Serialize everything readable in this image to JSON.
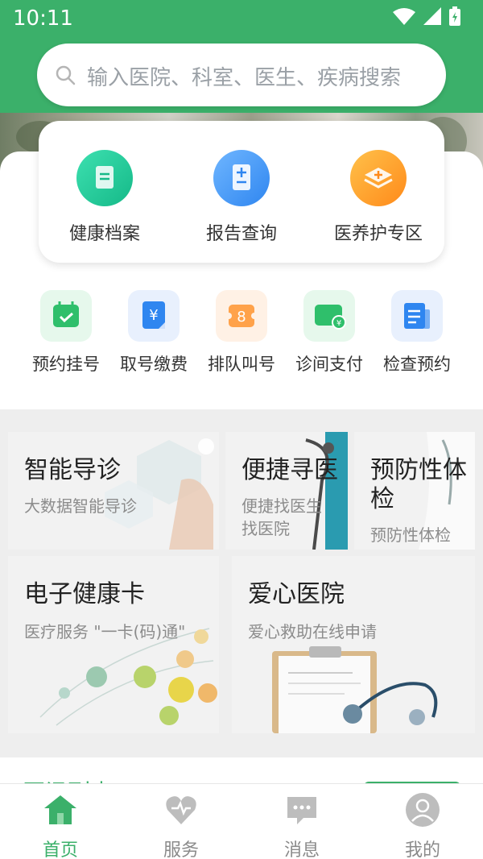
{
  "status": {
    "time": "10:11"
  },
  "search": {
    "placeholder": "输入医院、科室、医生、疾病搜索"
  },
  "top_features": [
    {
      "label": "健康档案",
      "icon": "document-icon",
      "color": "#15b988"
    },
    {
      "label": "报告查询",
      "icon": "report-icon",
      "color": "#2f86f0"
    },
    {
      "label": "医养护专区",
      "icon": "medical-box-icon",
      "color": "#ff8a1a"
    }
  ],
  "quick_actions": [
    {
      "label": "预约挂号",
      "icon": "calendar-check-icon"
    },
    {
      "label": "取号缴费",
      "icon": "yuan-card-icon"
    },
    {
      "label": "排队叫号",
      "icon": "ticket-number-icon",
      "badge": "8"
    },
    {
      "label": "诊间支付",
      "icon": "wallet-icon"
    },
    {
      "label": "检查预约",
      "icon": "checklist-icon"
    }
  ],
  "tiles": {
    "smart_guide": {
      "title": "智能导诊",
      "subtitle": "大数据智能导诊"
    },
    "find_doctor": {
      "title": "便捷寻医",
      "subtitle_1": "便捷找医生",
      "subtitle_2": "找医院"
    },
    "checkup": {
      "title_1": "预防性体",
      "title_2": "检",
      "subtitle": "预防性体检"
    },
    "health_card": {
      "title": "电子健康卡",
      "subtitle": "医疗服务 \"一卡(码)通\""
    },
    "charity": {
      "title": "爱心医院",
      "subtitle": "爱心救助在线申请"
    }
  },
  "news": {
    "title": "医讯列表"
  },
  "bottom_nav": [
    {
      "label": "首页",
      "icon": "home-icon",
      "active": true
    },
    {
      "label": "服务",
      "icon": "heart-icon",
      "active": false
    },
    {
      "label": "消息",
      "icon": "message-icon",
      "active": false
    },
    {
      "label": "我的",
      "icon": "user-icon",
      "active": false
    }
  ],
  "colors": {
    "brand": "#3bb06a",
    "active_tab": "#3bb06a",
    "inactive_tab": "#9e9e9e"
  }
}
